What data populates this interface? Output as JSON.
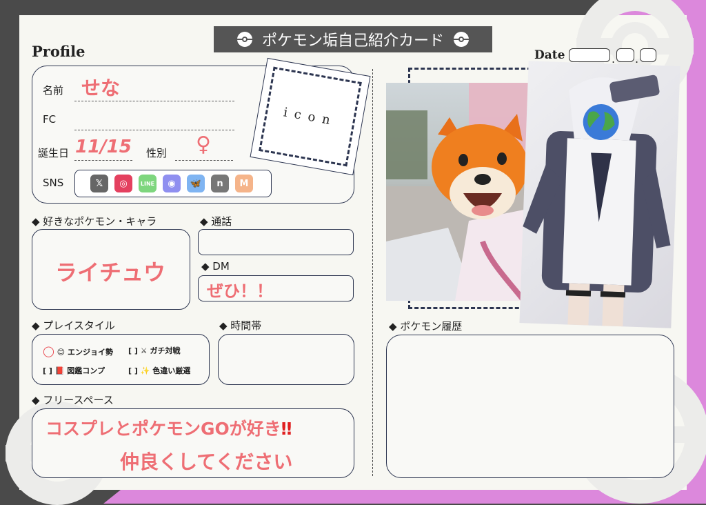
{
  "card_title": "ポケモン垢自己紹介カード",
  "profile_heading": "Profile",
  "date": {
    "label": "Date",
    "sep1": ".",
    "sep2": "."
  },
  "fields": {
    "name_label": "名前",
    "name_value": "せな",
    "fc_label": "FC",
    "birthday_label": "誕生日",
    "birthday_value": "11/15",
    "gender_label": "性別",
    "gender_value": "♀",
    "sns_label": "SNS"
  },
  "sns_icons": [
    {
      "name": "x-icon",
      "glyph": "𝕏",
      "color": "#666666"
    },
    {
      "name": "instagram-icon",
      "glyph": "◎",
      "color": "#e4405f"
    },
    {
      "name": "line-icon",
      "glyph": "LINE",
      "color": "#7ed67e"
    },
    {
      "name": "discord-icon",
      "glyph": "◉",
      "color": "#8f8ff0"
    },
    {
      "name": "bluesky-icon",
      "glyph": "🦋",
      "color": "#7fb4f2"
    },
    {
      "name": "note-icon",
      "glyph": "n",
      "color": "#777777"
    },
    {
      "name": "misskey-icon",
      "glyph": "M",
      "color": "#f5b48a"
    }
  ],
  "icon_placeholder": "icon",
  "favorite": {
    "label": "◆ 好きなポケモン・キャラ",
    "value": "ライチュウ"
  },
  "call": {
    "label": "◆ 通話"
  },
  "dm": {
    "label": "◆ DM",
    "value": "ぜひ！！"
  },
  "playstyle": {
    "label": "◆ プレイスタイル",
    "items": [
      {
        "mark": "◯",
        "icon": "😊",
        "text": "エンジョイ勢",
        "selected": true
      },
      {
        "mark": "[ ]",
        "icon": "⚔",
        "text": "ガチ対戦",
        "selected": false
      },
      {
        "mark": "[ ]",
        "icon": "📕",
        "text": "図鑑コンプ",
        "selected": false
      },
      {
        "mark": "[ ]",
        "icon": "✨",
        "text": "色違い厳選",
        "selected": false
      }
    ]
  },
  "time": {
    "label": "◆ 時間帯"
  },
  "free_space": {
    "label": "◆ フリースペース",
    "line1": "コスプレとポケモンGOが好き",
    "line1_mark": "‼",
    "line2": "仲良くしてください"
  },
  "pokemon_history": {
    "label": "◆ ポケモン履歴"
  },
  "colors": {
    "accent": "#ee6e74",
    "frame": "#2c3550",
    "pink": "#dc88dc",
    "header": "#555555"
  }
}
